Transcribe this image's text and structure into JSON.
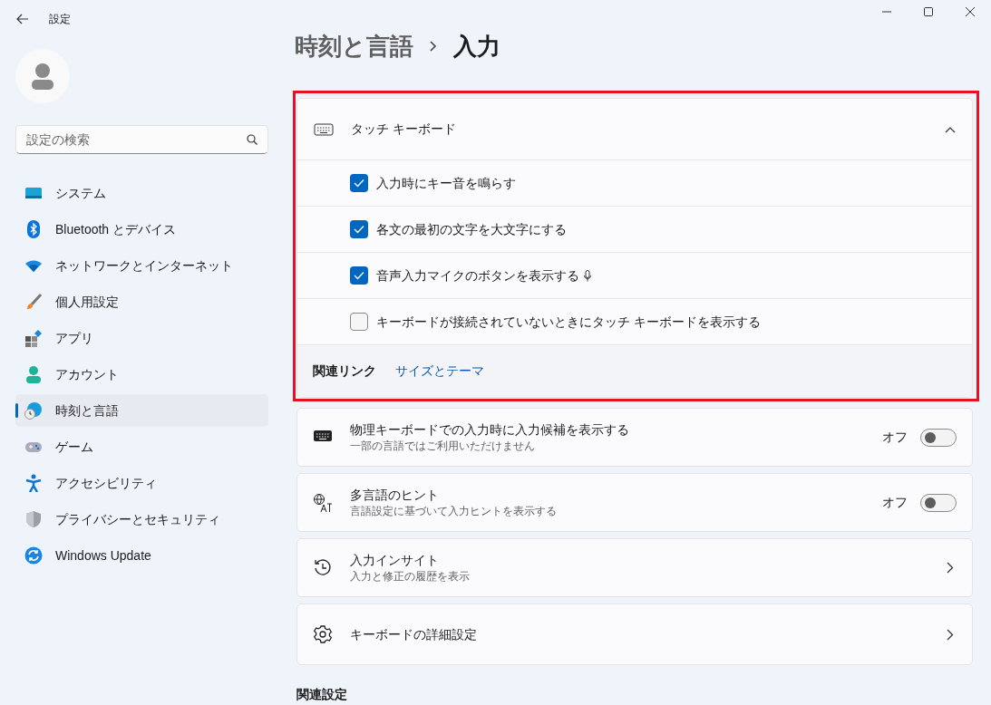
{
  "window": {
    "title": "設定"
  },
  "sidebar": {
    "search": {
      "placeholder": "設定の検索"
    },
    "items": [
      {
        "label": "システム",
        "selected": false
      },
      {
        "label": "Bluetooth とデバイス",
        "selected": false
      },
      {
        "label": "ネットワークとインターネット",
        "selected": false
      },
      {
        "label": "個人用設定",
        "selected": false
      },
      {
        "label": "アプリ",
        "selected": false
      },
      {
        "label": "アカウント",
        "selected": false
      },
      {
        "label": "時刻と言語",
        "selected": true
      },
      {
        "label": "ゲーム",
        "selected": false
      },
      {
        "label": "アクセシビリティ",
        "selected": false
      },
      {
        "label": "プライバシーとセキュリティ",
        "selected": false
      },
      {
        "label": "Windows Update",
        "selected": false
      }
    ]
  },
  "breadcrumb": {
    "parent": "時刻と言語",
    "current": "入力"
  },
  "touch_keyboard": {
    "title": "タッチ キーボード",
    "expanded": true,
    "options": [
      {
        "label": "入力時にキー音を鳴らす",
        "checked": true
      },
      {
        "label": "各文の最初の文字を大文字にする",
        "checked": true
      },
      {
        "label": "音声入力マイクのボタンを表示する",
        "checked": true,
        "microphone_icon": true
      },
      {
        "label": "キーボードが接続されていないときにタッチ キーボードを表示する",
        "checked": false
      }
    ],
    "related_links": {
      "label": "関連リンク",
      "links": [
        "サイズとテーマ"
      ]
    }
  },
  "settings": [
    {
      "kind": "toggle",
      "title": "物理キーボードでの入力時に入力候補を表示する",
      "subtitle": "一部の言語ではご利用いただけません",
      "state_label": "オフ",
      "on": false
    },
    {
      "kind": "toggle",
      "title": "多言語のヒント",
      "subtitle": "言語設定に基づいて入力ヒントを表示する",
      "state_label": "オフ",
      "on": false
    },
    {
      "kind": "link",
      "title": "入力インサイト",
      "subtitle": "入力と修正の履歴を表示"
    },
    {
      "kind": "link",
      "title": "キーボードの詳細設定"
    }
  ],
  "related_settings": {
    "heading": "関連設定"
  }
}
